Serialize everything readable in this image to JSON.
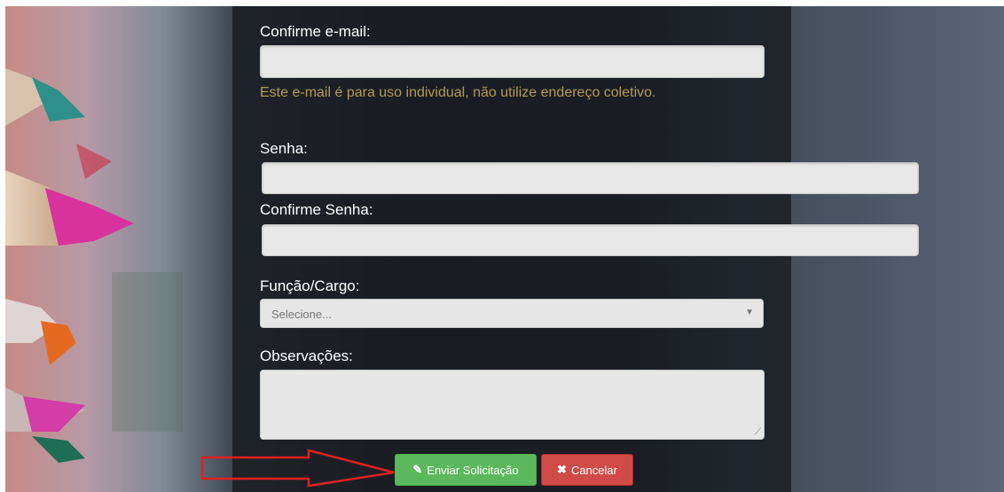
{
  "form": {
    "confirm_email_label": "Confirme e-mail:",
    "email_hint": "Este e-mail é para uso individual, não utilize endereço coletivo.",
    "password_label": "Senha:",
    "confirm_password_label": "Confirme Senha:",
    "role_label": "Função/Cargo:",
    "role_select_value": "Selecione...",
    "notes_label": "Observações:"
  },
  "buttons": {
    "submit_label": "Enviar Solicitação",
    "submit_icon": "pencil-icon",
    "cancel_label": "Cancelar",
    "cancel_icon": "close-icon"
  },
  "colors": {
    "hint": "#b49a55",
    "submit": "#5cb85c",
    "cancel": "#d04b47",
    "annotation_arrow": "#e02020"
  }
}
